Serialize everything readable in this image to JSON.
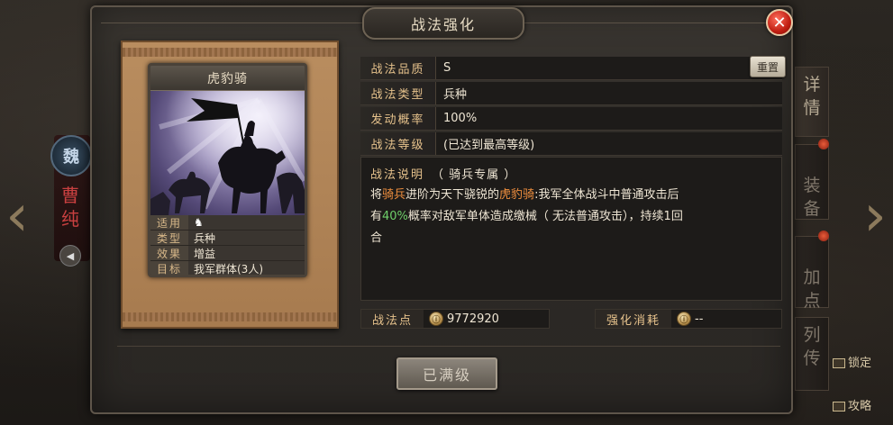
{
  "dialog": {
    "title": "战法强化"
  },
  "card": {
    "title": "虎豹骑",
    "info": [
      {
        "key": "适用",
        "value": ""
      },
      {
        "key": "类型",
        "value": "兵种"
      },
      {
        "key": "效果",
        "value": "增益"
      },
      {
        "key": "目标",
        "value": "我军群体(3人)"
      }
    ]
  },
  "details": {
    "rows": [
      {
        "key": "战法品质",
        "value": "S"
      },
      {
        "key": "战法类型",
        "value": "兵种"
      },
      {
        "key": "发动概率",
        "value": "100%"
      },
      {
        "key": "战法等级",
        "value": "(已达到最高等级)"
      }
    ],
    "reset_label": "重置"
  },
  "description": {
    "heading": "战法说明",
    "subheading": "（ 骑兵专属 ）",
    "line1_a": "将",
    "line1_b": "骑兵",
    "line1_c": "进阶为天下骁锐的",
    "line1_d": "虎豹骑",
    "line1_e": ":我军全体战斗中普通攻击后",
    "line2_a": "有",
    "line2_b": "40%",
    "line2_c": "概率对敌军单体造成缴械（ 无法普通攻击），持续1回",
    "line3": "合"
  },
  "points": {
    "label": "战法点",
    "value": "9772920",
    "cost_label": "强化消耗",
    "cost_value": "--"
  },
  "action": {
    "max_label": "已满级"
  },
  "side_tabs": [
    {
      "label": "详\n情"
    },
    {
      "label": "装\n备"
    },
    {
      "label": "加\n点"
    },
    {
      "label": "列\n传"
    }
  ],
  "background": {
    "seal_char": "魏",
    "general_name": "曹\n纯",
    "lock_label": "锁定",
    "guide_label": "攻略"
  },
  "colors": {
    "accent_gold": "#e6c28c",
    "highlight_orange": "#f08f3e",
    "highlight_green": "#6fcf6a",
    "close_red": "#c01e12"
  }
}
